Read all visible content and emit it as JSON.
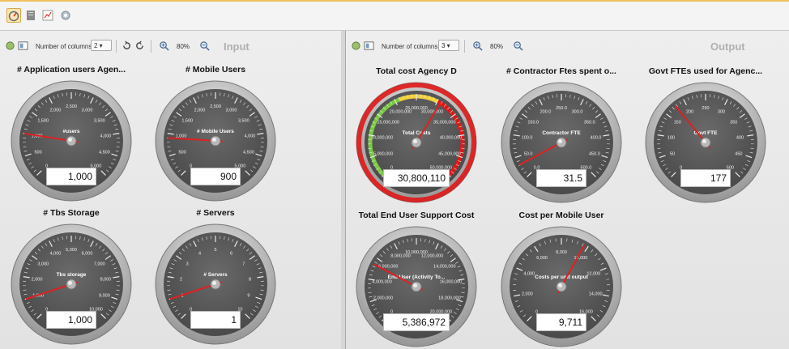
{
  "toolbar": {
    "icons": [
      "gauge-view-icon",
      "document-icon",
      "chart-icon",
      "settings-icon"
    ]
  },
  "input_panel": {
    "title": "Input",
    "columns_label": "Number of columns",
    "columns_value": "2",
    "zoom": "80%",
    "gauges": [
      {
        "title": "# Application users Agen...",
        "center_label": "#users",
        "value": "1,000",
        "ticks": [
          "0",
          "500",
          "1,000",
          "1,500",
          "2,000",
          "2,500",
          "3,000",
          "3,500",
          "4,000",
          "4,500",
          "5,000"
        ],
        "needle": 0.2
      },
      {
        "title": "# Mobile Users",
        "center_label": "# Mobile Users",
        "value": "900",
        "ticks": [
          "0",
          "500",
          "1,000",
          "1,500",
          "2,000",
          "2,500",
          "3,000",
          "3,500",
          "4,000",
          "4,500",
          "5,000"
        ],
        "needle": 0.18
      },
      {
        "title": "# Tbs Storage",
        "center_label": "Tbs storage",
        "value": "1,000",
        "ticks": [
          "0",
          "1,000",
          "2,000",
          "3,000",
          "4,000",
          "5,000",
          "6,000",
          "7,000",
          "8,000",
          "9,000",
          "10,000"
        ],
        "needle": 0.1
      },
      {
        "title": "# Servers",
        "center_label": "# Servers",
        "value": "1",
        "ticks": [
          "0",
          "1",
          "2",
          "3",
          "4",
          "5",
          "6",
          "7",
          "8",
          "9",
          "10"
        ],
        "needle": 0.1
      }
    ]
  },
  "output_panel": {
    "title": "Output",
    "columns_label": "Number of columns",
    "columns_value": "3",
    "zoom": "80%",
    "gauges": [
      {
        "title": "Total cost Agency D",
        "center_label": "Total Costs",
        "value": "30,800,110",
        "ticks": [
          "0",
          "5,000,000",
          "10,000,000",
          "15,000,000",
          "20,000,000",
          "25,000,000",
          "30,000,000",
          "35,000,000",
          "40,000,000",
          "45,000,000",
          "50,000,000"
        ],
        "needle": 0.616,
        "highlight": true
      },
      {
        "title": "# Contractor Ftes spent o...",
        "center_label": "Contractor FTE",
        "value": "31.5",
        "ticks": [
          "0.0",
          "50.0",
          "100.0",
          "150.0",
          "200.0",
          "250.0",
          "300.0",
          "350.0",
          "400.0",
          "450.0",
          "500.0"
        ],
        "needle": 0.063
      },
      {
        "title": "Govt FTEs used for Agenc...",
        "center_label": "Govt FTE",
        "value": "177",
        "ticks": [
          "0",
          "50",
          "100",
          "150",
          "200",
          "250",
          "300",
          "350",
          "400",
          "450",
          "500"
        ],
        "needle": 0.354
      },
      {
        "title": "Total End User Support Cost",
        "center_label": "End User (Activity To...",
        "value": "5,386,972",
        "ticks": [
          "0",
          "2,000,000",
          "4,000,000",
          "6,000,000",
          "8,000,000",
          "10,000,000",
          "12,000,000",
          "14,000,000",
          "16,000,000",
          "18,000,000",
          "20,000,000"
        ],
        "needle": 0.27
      },
      {
        "title": "Cost per Mobile User",
        "center_label": "Costs per unit output",
        "value": "9,711",
        "ticks": [
          "0",
          "2,000",
          "4,000",
          "6,000",
          "8,000",
          "10,000",
          "12,000",
          "14,000",
          "16,000"
        ],
        "needle": 0.607
      }
    ]
  },
  "colors": {
    "needle": "#e02020",
    "dial": "#4a4a4a",
    "highlight_red": "#e01818",
    "highlight_green": "#7ac943",
    "highlight_yellow": "#f2d23a"
  }
}
